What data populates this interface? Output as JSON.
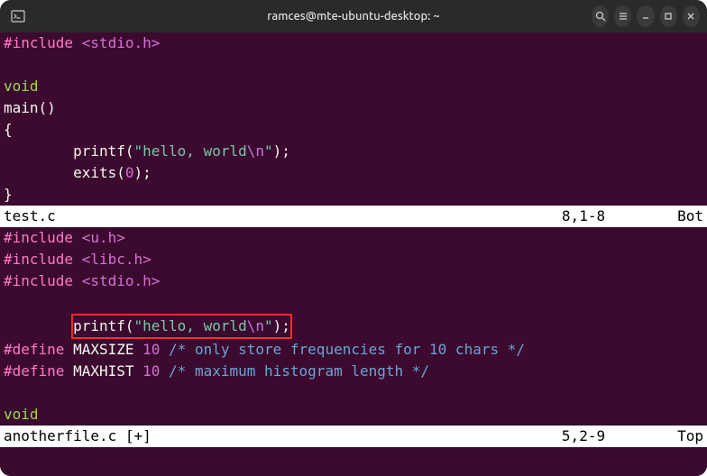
{
  "titlebar": {
    "title": "ramces@mte-ubuntu-desktop: ~"
  },
  "pane1": {
    "lines": {
      "l1_pre": "#include",
      "l1_inc": " <stdio.h>",
      "l3_type": "void",
      "l4_func": "main",
      "l4_paren": "()",
      "l5_brace": "{",
      "l6_indent": "        ",
      "l6_func": "printf",
      "l6_open": "(",
      "l6_str1": "\"hello, world",
      "l6_esc": "\\n",
      "l6_str2": "\"",
      "l6_close": ");",
      "l7_indent": "        ",
      "l7_func": "exits",
      "l7_open": "(",
      "l7_arg": "0",
      "l7_close": ");",
      "l8_brace": "}"
    },
    "status": {
      "filename": "test.c",
      "position": "8,1-8",
      "scroll": "Bot"
    }
  },
  "pane2": {
    "lines": {
      "l1_pre": "#include",
      "l1_inc": " <u.h>",
      "l2_pre": "#include",
      "l2_inc": " <libc.h>",
      "l3_pre": "#include",
      "l3_inc": " <stdio.h>",
      "l5_indent": "        ",
      "l5_func": "printf",
      "l5_open": "(",
      "l5_str1": "\"hello, world",
      "l5_esc": "\\n",
      "l5_str2": "\"",
      "l5_close": ");",
      "l6_pre": "#define",
      "l6_name": " MAXSIZE ",
      "l6_val": "10",
      "l6_sp": " ",
      "l6_com": "/* only store frequencies for 10 chars */",
      "l7_pre": "#define",
      "l7_name": " MAXHIST ",
      "l7_val": "10",
      "l7_sp": " ",
      "l7_com": "/* maximum histogram length */",
      "l9_type": "void"
    },
    "status": {
      "filename": "anotherfile.c [+]",
      "position": "5,2-9",
      "scroll": "Top"
    }
  }
}
